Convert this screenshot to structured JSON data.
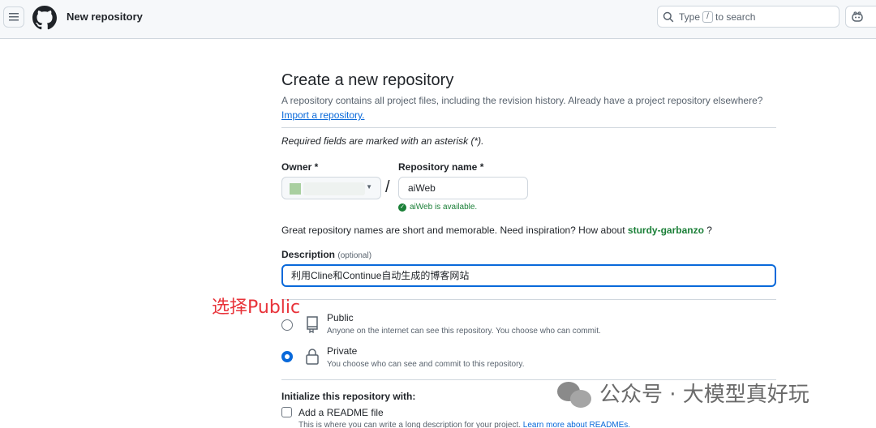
{
  "header": {
    "title": "New repository",
    "search_prefix": "Type",
    "search_key": "/",
    "search_suffix": "to search"
  },
  "form": {
    "title": "Create a new repository",
    "subtitle": "A repository contains all project files, including the revision history. Already have a project repository elsewhere?",
    "import_link": "Import a repository.",
    "required_note": "Required fields are marked with an asterisk (*).",
    "owner_label": "Owner *",
    "repo_label": "Repository name *",
    "repo_value": "aiWeb",
    "available_text": "aiWeb is available.",
    "inspiration_text": "Great repository names are short and memorable. Need inspiration? How about",
    "suggestion": "sturdy-garbanzo",
    "suggestion_suffix": "?",
    "description_label": "Description",
    "description_optional": "(optional)",
    "description_value": "利用Cline和Continue自动生成的博客网站",
    "visibility": [
      {
        "title": "Public",
        "desc": "Anyone on the internet can see this repository. You choose who can commit.",
        "selected": false
      },
      {
        "title": "Private",
        "desc": "You choose who can see and commit to this repository.",
        "selected": true
      }
    ],
    "init_label": "Initialize this repository with:",
    "readme_label": "Add a README file",
    "readme_desc": "This is where you can write a long description for your project.",
    "readme_link": "Learn more about READMEs."
  },
  "annotation": "选择Public",
  "watermark": "公众号 · 大模型真好玩",
  "colors": {
    "accent": "#0969da",
    "success": "#1a7f37",
    "annotation": "#e8333a"
  }
}
